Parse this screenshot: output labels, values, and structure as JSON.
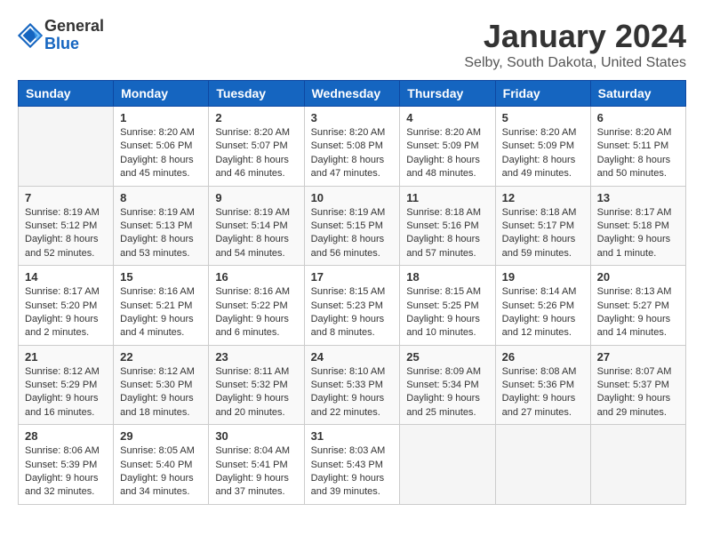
{
  "header": {
    "logo_general": "General",
    "logo_blue": "Blue",
    "title": "January 2024",
    "location": "Selby, South Dakota, United States"
  },
  "days_of_week": [
    "Sunday",
    "Monday",
    "Tuesday",
    "Wednesday",
    "Thursday",
    "Friday",
    "Saturday"
  ],
  "weeks": [
    [
      {
        "day": "",
        "sunrise": "",
        "sunset": "",
        "daylight": ""
      },
      {
        "day": "1",
        "sunrise": "Sunrise: 8:20 AM",
        "sunset": "Sunset: 5:06 PM",
        "daylight": "Daylight: 8 hours and 45 minutes."
      },
      {
        "day": "2",
        "sunrise": "Sunrise: 8:20 AM",
        "sunset": "Sunset: 5:07 PM",
        "daylight": "Daylight: 8 hours and 46 minutes."
      },
      {
        "day": "3",
        "sunrise": "Sunrise: 8:20 AM",
        "sunset": "Sunset: 5:08 PM",
        "daylight": "Daylight: 8 hours and 47 minutes."
      },
      {
        "day": "4",
        "sunrise": "Sunrise: 8:20 AM",
        "sunset": "Sunset: 5:09 PM",
        "daylight": "Daylight: 8 hours and 48 minutes."
      },
      {
        "day": "5",
        "sunrise": "Sunrise: 8:20 AM",
        "sunset": "Sunset: 5:09 PM",
        "daylight": "Daylight: 8 hours and 49 minutes."
      },
      {
        "day": "6",
        "sunrise": "Sunrise: 8:20 AM",
        "sunset": "Sunset: 5:11 PM",
        "daylight": "Daylight: 8 hours and 50 minutes."
      }
    ],
    [
      {
        "day": "7",
        "sunrise": "Sunrise: 8:19 AM",
        "sunset": "Sunset: 5:12 PM",
        "daylight": "Daylight: 8 hours and 52 minutes."
      },
      {
        "day": "8",
        "sunrise": "Sunrise: 8:19 AM",
        "sunset": "Sunset: 5:13 PM",
        "daylight": "Daylight: 8 hours and 53 minutes."
      },
      {
        "day": "9",
        "sunrise": "Sunrise: 8:19 AM",
        "sunset": "Sunset: 5:14 PM",
        "daylight": "Daylight: 8 hours and 54 minutes."
      },
      {
        "day": "10",
        "sunrise": "Sunrise: 8:19 AM",
        "sunset": "Sunset: 5:15 PM",
        "daylight": "Daylight: 8 hours and 56 minutes."
      },
      {
        "day": "11",
        "sunrise": "Sunrise: 8:18 AM",
        "sunset": "Sunset: 5:16 PM",
        "daylight": "Daylight: 8 hours and 57 minutes."
      },
      {
        "day": "12",
        "sunrise": "Sunrise: 8:18 AM",
        "sunset": "Sunset: 5:17 PM",
        "daylight": "Daylight: 8 hours and 59 minutes."
      },
      {
        "day": "13",
        "sunrise": "Sunrise: 8:17 AM",
        "sunset": "Sunset: 5:18 PM",
        "daylight": "Daylight: 9 hours and 1 minute."
      }
    ],
    [
      {
        "day": "14",
        "sunrise": "Sunrise: 8:17 AM",
        "sunset": "Sunset: 5:20 PM",
        "daylight": "Daylight: 9 hours and 2 minutes."
      },
      {
        "day": "15",
        "sunrise": "Sunrise: 8:16 AM",
        "sunset": "Sunset: 5:21 PM",
        "daylight": "Daylight: 9 hours and 4 minutes."
      },
      {
        "day": "16",
        "sunrise": "Sunrise: 8:16 AM",
        "sunset": "Sunset: 5:22 PM",
        "daylight": "Daylight: 9 hours and 6 minutes."
      },
      {
        "day": "17",
        "sunrise": "Sunrise: 8:15 AM",
        "sunset": "Sunset: 5:23 PM",
        "daylight": "Daylight: 9 hours and 8 minutes."
      },
      {
        "day": "18",
        "sunrise": "Sunrise: 8:15 AM",
        "sunset": "Sunset: 5:25 PM",
        "daylight": "Daylight: 9 hours and 10 minutes."
      },
      {
        "day": "19",
        "sunrise": "Sunrise: 8:14 AM",
        "sunset": "Sunset: 5:26 PM",
        "daylight": "Daylight: 9 hours and 12 minutes."
      },
      {
        "day": "20",
        "sunrise": "Sunrise: 8:13 AM",
        "sunset": "Sunset: 5:27 PM",
        "daylight": "Daylight: 9 hours and 14 minutes."
      }
    ],
    [
      {
        "day": "21",
        "sunrise": "Sunrise: 8:12 AM",
        "sunset": "Sunset: 5:29 PM",
        "daylight": "Daylight: 9 hours and 16 minutes."
      },
      {
        "day": "22",
        "sunrise": "Sunrise: 8:12 AM",
        "sunset": "Sunset: 5:30 PM",
        "daylight": "Daylight: 9 hours and 18 minutes."
      },
      {
        "day": "23",
        "sunrise": "Sunrise: 8:11 AM",
        "sunset": "Sunset: 5:32 PM",
        "daylight": "Daylight: 9 hours and 20 minutes."
      },
      {
        "day": "24",
        "sunrise": "Sunrise: 8:10 AM",
        "sunset": "Sunset: 5:33 PM",
        "daylight": "Daylight: 9 hours and 22 minutes."
      },
      {
        "day": "25",
        "sunrise": "Sunrise: 8:09 AM",
        "sunset": "Sunset: 5:34 PM",
        "daylight": "Daylight: 9 hours and 25 minutes."
      },
      {
        "day": "26",
        "sunrise": "Sunrise: 8:08 AM",
        "sunset": "Sunset: 5:36 PM",
        "daylight": "Daylight: 9 hours and 27 minutes."
      },
      {
        "day": "27",
        "sunrise": "Sunrise: 8:07 AM",
        "sunset": "Sunset: 5:37 PM",
        "daylight": "Daylight: 9 hours and 29 minutes."
      }
    ],
    [
      {
        "day": "28",
        "sunrise": "Sunrise: 8:06 AM",
        "sunset": "Sunset: 5:39 PM",
        "daylight": "Daylight: 9 hours and 32 minutes."
      },
      {
        "day": "29",
        "sunrise": "Sunrise: 8:05 AM",
        "sunset": "Sunset: 5:40 PM",
        "daylight": "Daylight: 9 hours and 34 minutes."
      },
      {
        "day": "30",
        "sunrise": "Sunrise: 8:04 AM",
        "sunset": "Sunset: 5:41 PM",
        "daylight": "Daylight: 9 hours and 37 minutes."
      },
      {
        "day": "31",
        "sunrise": "Sunrise: 8:03 AM",
        "sunset": "Sunset: 5:43 PM",
        "daylight": "Daylight: 9 hours and 39 minutes."
      },
      {
        "day": "",
        "sunrise": "",
        "sunset": "",
        "daylight": ""
      },
      {
        "day": "",
        "sunrise": "",
        "sunset": "",
        "daylight": ""
      },
      {
        "day": "",
        "sunrise": "",
        "sunset": "",
        "daylight": ""
      }
    ]
  ]
}
